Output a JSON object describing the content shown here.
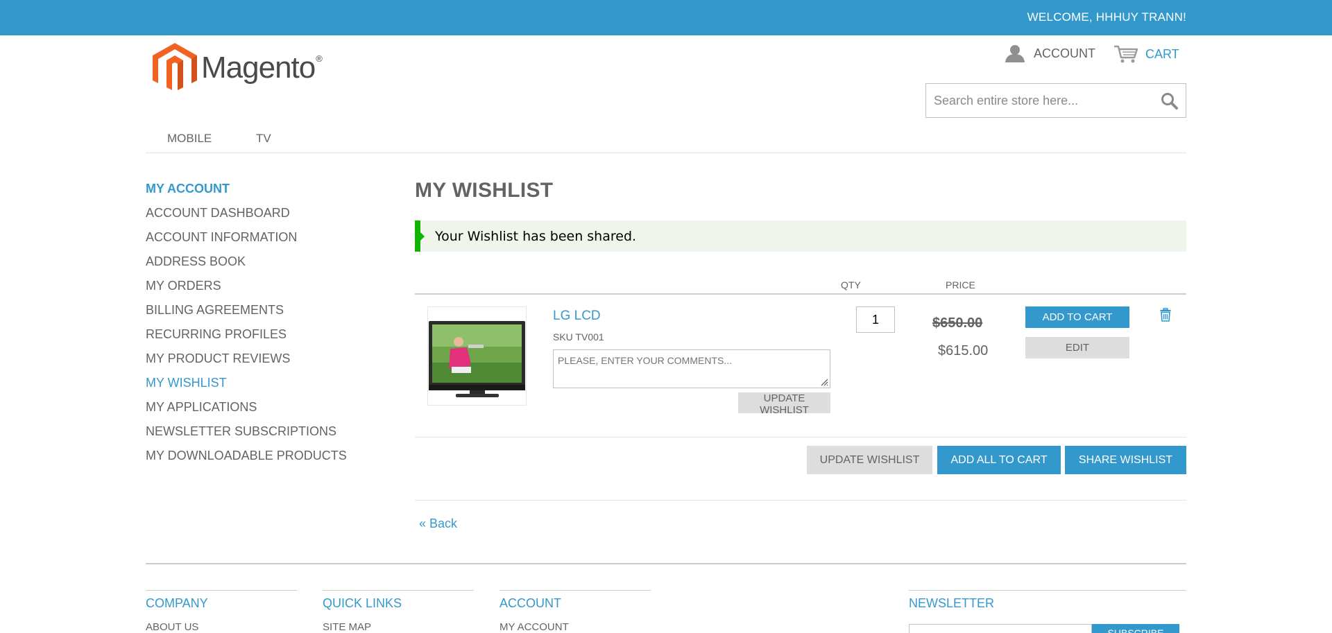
{
  "header": {
    "welcome": "WELCOME, HHHUY TRANN!",
    "logo_text": "Magento",
    "logo_mark": "®",
    "account_label": "ACCOUNT",
    "cart_label": "CART",
    "search_placeholder": "Search entire store here..."
  },
  "nav": {
    "items": [
      {
        "label": "MOBILE"
      },
      {
        "label": "TV"
      }
    ]
  },
  "sidebar": {
    "title": "MY ACCOUNT",
    "items": [
      {
        "label": "ACCOUNT DASHBOARD",
        "active": false
      },
      {
        "label": "ACCOUNT INFORMATION",
        "active": false
      },
      {
        "label": "ADDRESS BOOK",
        "active": false
      },
      {
        "label": "MY ORDERS",
        "active": false
      },
      {
        "label": "BILLING AGREEMENTS",
        "active": false
      },
      {
        "label": "RECURRING PROFILES",
        "active": false
      },
      {
        "label": "MY PRODUCT REVIEWS",
        "active": false
      },
      {
        "label": "MY WISHLIST",
        "active": true
      },
      {
        "label": "MY APPLICATIONS",
        "active": false
      },
      {
        "label": "NEWSLETTER SUBSCRIPTIONS",
        "active": false
      },
      {
        "label": "MY DOWNLOADABLE PRODUCTS",
        "active": false
      }
    ]
  },
  "main": {
    "title": "MY WISHLIST",
    "success_message": "Your Wishlist has been shared.",
    "table_headers": {
      "qty": "QTY",
      "price": "PRICE"
    },
    "item": {
      "name": "LG LCD",
      "sku": "SKU TV001",
      "comment_placeholder": "PLEASE, ENTER YOUR COMMENTS...",
      "update_label": "UPDATE WISHLIST",
      "qty": "1",
      "old_price": "$650.00",
      "new_price": "$615.00",
      "add_to_cart_label": "ADD TO CART",
      "edit_label": "EDIT"
    },
    "actions": {
      "update_label": "UPDATE WISHLIST",
      "add_all_label": "ADD ALL TO CART",
      "share_label": "SHARE WISHLIST"
    },
    "back_label": "« Back"
  },
  "footer": {
    "company": {
      "title": "COMPANY",
      "first_link": "ABOUT US"
    },
    "quick_links": {
      "title": "QUICK LINKS",
      "first_link": "SITE MAP"
    },
    "account": {
      "title": "ACCOUNT",
      "first_link": "MY ACCOUNT"
    },
    "newsletter": {
      "title": "NEWSLETTER",
      "button_label": "SUBSCRIBE"
    }
  },
  "colors": {
    "brand_blue": "#3399cc",
    "success_green": "#11b400",
    "success_bg": "#eff5ea",
    "logo_orange": "#f26322"
  }
}
